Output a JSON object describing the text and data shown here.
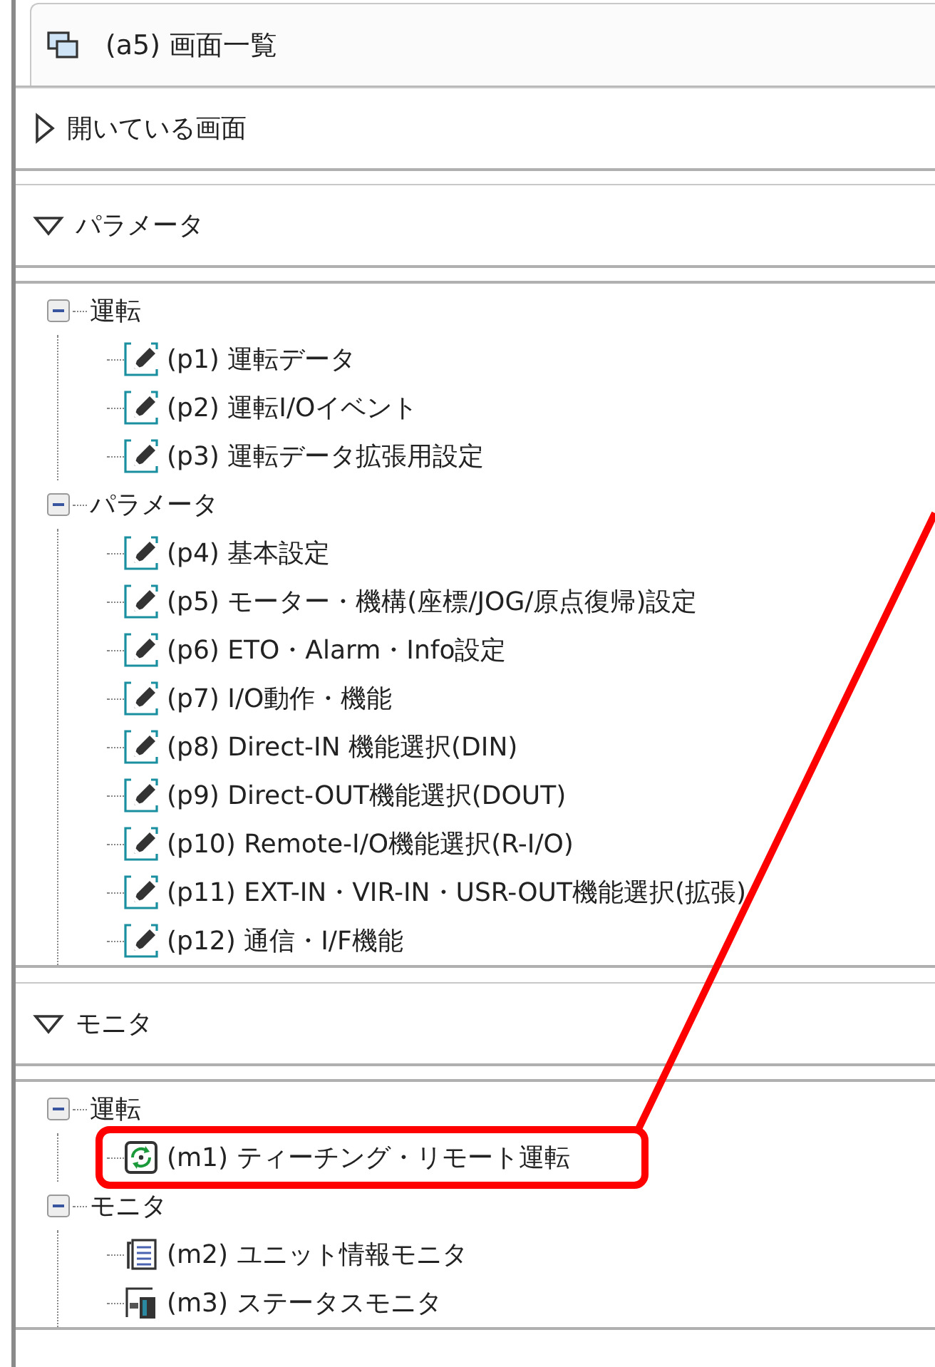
{
  "tab": {
    "title": "(a5) 画面一覧",
    "selected": true
  },
  "sections": [
    {
      "title": "開いている画面",
      "expanded": false
    },
    {
      "title": "パラメータ",
      "expanded": true,
      "tree": [
        {
          "label": "運転",
          "expanded": true,
          "children": [
            {
              "label": "(p1) 運転データ",
              "kind": "edit",
              "highlighted": false
            },
            {
              "label": "(p2) 運転I/Oイベント",
              "kind": "edit",
              "highlighted": false
            },
            {
              "label": "(p3) 運転データ拡張用設定",
              "kind": "edit",
              "highlighted": false
            }
          ]
        },
        {
          "label": "パラメータ",
          "expanded": true,
          "children": [
            {
              "label": "(p4) 基本設定",
              "kind": "edit",
              "highlighted": false
            },
            {
              "label": "(p5) モーター・機構(座標/JOG/原点復帰)設定",
              "kind": "edit",
              "highlighted": false
            },
            {
              "label": "(p6) ETO・Alarm・Info設定",
              "kind": "edit",
              "highlighted": false
            },
            {
              "label": "(p7) I/O動作・機能",
              "kind": "edit",
              "highlighted": false
            },
            {
              "label": "(p8) Direct-IN 機能選択(DIN)",
              "kind": "edit",
              "highlighted": false
            },
            {
              "label": "(p9) Direct-OUT機能選択(DOUT)",
              "kind": "edit",
              "highlighted": false
            },
            {
              "label": "(p10) Remote-I/O機能選択(R-I/O)",
              "kind": "edit",
              "highlighted": false
            },
            {
              "label": "(p11) EXT-IN・VIR-IN・USR-OUT機能選択(拡張)",
              "kind": "edit",
              "highlighted": false
            },
            {
              "label": "(p12) 通信・I/F機能",
              "kind": "edit",
              "highlighted": false
            }
          ]
        }
      ]
    },
    {
      "title": "モニタ",
      "expanded": true,
      "tree": [
        {
          "label": "運転",
          "expanded": true,
          "children": [
            {
              "label": "(m1) ティーチング・リモート運転",
              "kind": "teaching",
              "highlighted": true
            }
          ]
        },
        {
          "label": "モニタ",
          "expanded": true,
          "children": [
            {
              "label": "(m2) ユニット情報モニタ",
              "kind": "info",
              "highlighted": false
            },
            {
              "label": "(m3) ステータスモニタ",
              "kind": "status",
              "highlighted": false
            }
          ]
        }
      ]
    }
  ]
}
